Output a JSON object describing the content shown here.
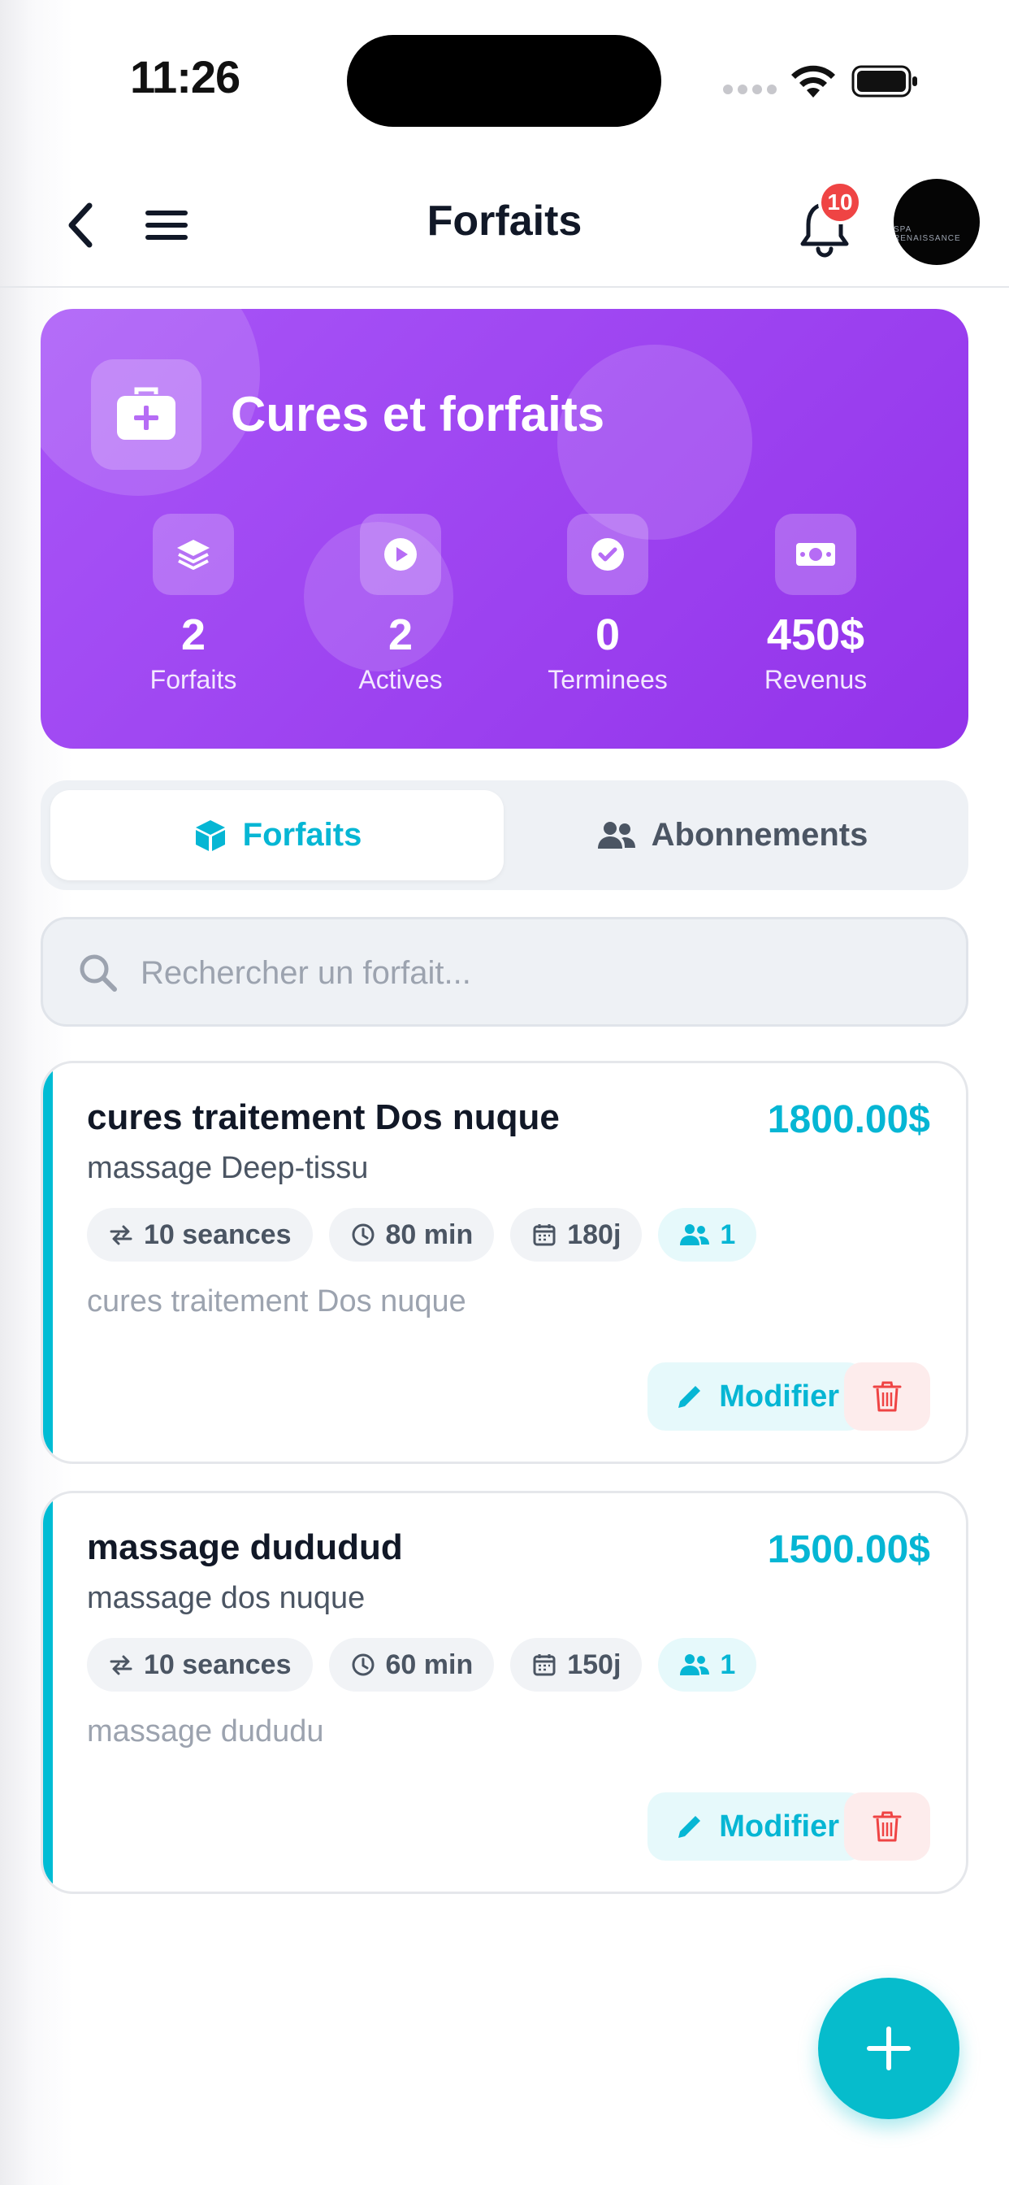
{
  "status_bar": {
    "time": "11:26"
  },
  "header": {
    "title": "Forfaits",
    "notification_count": "10",
    "avatar_text": "SPA RENAISSANCE"
  },
  "hero": {
    "title": "Cures et forfaits",
    "stats": [
      {
        "icon": "layers-icon",
        "value": "2",
        "label": "Forfaits"
      },
      {
        "icon": "play-icon",
        "value": "2",
        "label": "Actives"
      },
      {
        "icon": "check-circle-icon",
        "value": "0",
        "label": "Terminees"
      },
      {
        "icon": "money-icon",
        "value": "450$",
        "label": "Revenus"
      }
    ]
  },
  "tabs": [
    {
      "label": "Forfaits",
      "active": true,
      "icon": "cube-icon"
    },
    {
      "label": "Abonnements",
      "active": false,
      "icon": "users-icon"
    }
  ],
  "search": {
    "placeholder": "Rechercher un forfait...",
    "value": ""
  },
  "packages": [
    {
      "title": "cures traitement Dos nuque",
      "price": "1800.00$",
      "subtitle": "massage Deep-tissu",
      "sessions": "10 seances",
      "duration": "80 min",
      "validity": "180j",
      "members": "1",
      "description": "cures traitement Dos nuque",
      "edit_label": "Modifier"
    },
    {
      "title": "massage dududud",
      "price": "1500.00$",
      "subtitle": "massage dos nuque",
      "sessions": "10 seances",
      "duration": "60 min",
      "validity": "150j",
      "members": "1",
      "description": "massage dududu",
      "edit_label": "Modifier"
    }
  ],
  "colors": {
    "accent": "#06b6d4",
    "hero_start": "#a855f7",
    "hero_end": "#9333ea",
    "danger": "#ef4444"
  }
}
